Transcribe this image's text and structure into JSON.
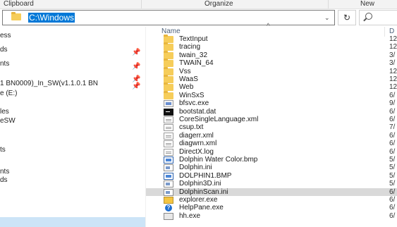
{
  "ribbon": {
    "clipboard": "Clipboard",
    "organize": "Organize",
    "new": "New"
  },
  "address": {
    "path": "C:\\Windows",
    "dropdown_glyph": "⌄",
    "refresh_glyph": "↻"
  },
  "nav": {
    "items": [
      {
        "label": "ess",
        "pinned": false
      },
      {
        "label": "ds",
        "pinned": true
      },
      {
        "label": "nts",
        "pinned": true
      },
      {
        "label": "",
        "pinned": true
      },
      {
        "label": "1 BN0009)_In_SW(v1.1.0.1 BN",
        "pinned": true
      },
      {
        "label": "e (E:)",
        "pinned": false
      },
      {
        "label": "les",
        "pinned": false
      },
      {
        "label": "eSW",
        "pinned": false
      },
      {
        "label": "",
        "pinned": false
      },
      {
        "label": "ts",
        "pinned": false
      },
      {
        "label": "",
        "pinned": false
      },
      {
        "label": "nts",
        "pinned": false
      },
      {
        "label": "ds",
        "pinned": false
      },
      {
        "label": "",
        "pinned": false
      },
      {
        "label": "",
        "pinned": false
      }
    ],
    "pin_glyph": "📌"
  },
  "list": {
    "sort_glyph": "^",
    "header": {
      "name": "Name",
      "date": "D"
    },
    "rows": [
      {
        "name": "TextInput",
        "date": "12",
        "icon": "folder-icon"
      },
      {
        "name": "tracing",
        "date": "12",
        "icon": "folder-icon"
      },
      {
        "name": "twain_32",
        "date": "3/",
        "icon": "folder-icon"
      },
      {
        "name": "TWAIN_64",
        "date": "3/",
        "icon": "folder-icon"
      },
      {
        "name": "Vss",
        "date": "12",
        "icon": "folder-icon"
      },
      {
        "name": "WaaS",
        "date": "12",
        "icon": "folder-icon"
      },
      {
        "name": "Web",
        "date": "12",
        "icon": "folder-icon"
      },
      {
        "name": "WinSxS",
        "date": "6/",
        "icon": "folder-icon"
      },
      {
        "name": "bfsvc.exe",
        "date": "9/",
        "icon": "exe-icon"
      },
      {
        "name": "bootstat.dat",
        "date": "6/",
        "icon": "dat-icon"
      },
      {
        "name": "CoreSingleLanguage.xml",
        "date": "6/",
        "icon": "xml-icon"
      },
      {
        "name": "csup.txt",
        "date": "7/",
        "icon": "txt-icon"
      },
      {
        "name": "diagerr.xml",
        "date": "6/",
        "icon": "xml-icon"
      },
      {
        "name": "diagwrn.xml",
        "date": "6/",
        "icon": "xml-icon"
      },
      {
        "name": "DirectX.log",
        "date": "6/",
        "icon": "log-icon"
      },
      {
        "name": "Dolphin Water Color.bmp",
        "date": "5/",
        "icon": "bmp-icon"
      },
      {
        "name": "Dolphin.ini",
        "date": "5/",
        "icon": "ini-icon"
      },
      {
        "name": "DOLPHIN1.BMP",
        "date": "5/",
        "icon": "bmp-icon"
      },
      {
        "name": "Dolphin3D.ini",
        "date": "5/",
        "icon": "ini-icon"
      },
      {
        "name": "DolphinScan.ini",
        "date": "6/",
        "icon": "ini-icon",
        "selected": true
      },
      {
        "name": "explorer.exe",
        "date": "6/",
        "icon": "explorer-icon"
      },
      {
        "name": "HelpPane.exe",
        "date": "6/",
        "icon": "help-icon"
      },
      {
        "name": "hh.exe",
        "date": "6/",
        "icon": "hh-icon"
      }
    ]
  }
}
